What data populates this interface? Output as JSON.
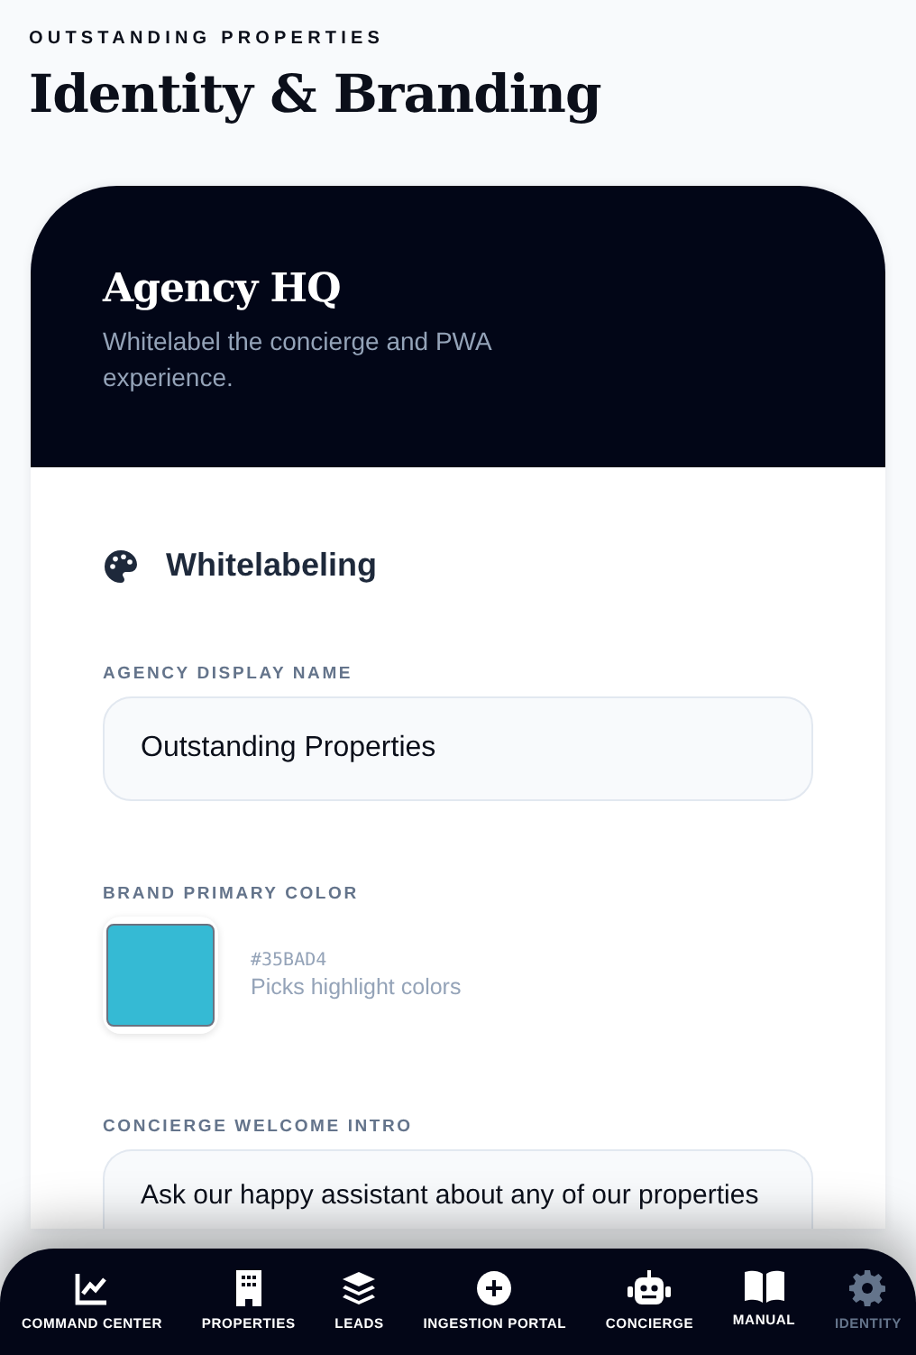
{
  "header": {
    "eyebrow": "OUTSTANDING PROPERTIES",
    "title": "Identity & Branding"
  },
  "card": {
    "title": "Agency HQ",
    "subtitle": "Whitelabel the concierge and PWA experience.",
    "section": "Whitelabeling",
    "fields": [
      {
        "kind": "text",
        "label": "AGENCY DISPLAY NAME",
        "value": "Outstanding Properties"
      },
      {
        "kind": "color",
        "label": "BRAND PRIMARY COLOR",
        "color": "#35bad4",
        "value": "#35BAD4",
        "hint": "Picks highlight colors"
      },
      {
        "kind": "textarea",
        "label": "CONCIERGE WELCOME INTRO",
        "value": "Ask our happy assistant about any of our properties"
      }
    ]
  },
  "nav": [
    {
      "label": "COMMAND CENTER",
      "selected": false
    },
    {
      "label": "PROPERTIES",
      "selected": false
    },
    {
      "label": "LEADS",
      "selected": false
    },
    {
      "label": "INGESTION PORTAL",
      "selected": false
    },
    {
      "label": "CONCIERGE",
      "selected": false
    },
    {
      "label": "MANUAL",
      "selected": false
    },
    {
      "label": "IDENTITY",
      "selected": true
    }
  ]
}
